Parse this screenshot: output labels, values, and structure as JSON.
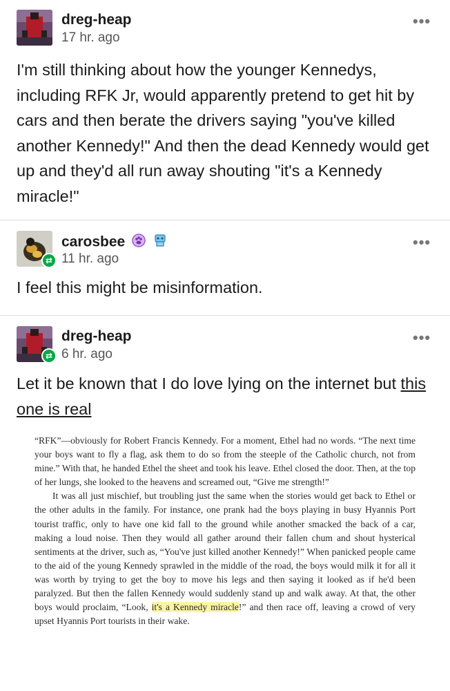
{
  "posts": [
    {
      "username": "dreg-heap",
      "time": "17 hr. ago",
      "body": "I'm still thinking about how the younger Kennedys, including RFK Jr, would apparently pretend to get hit by cars and then berate the drivers saying \"you've killed another Kennedy!\" And then the dead Kennedy would get up and they'd all run away shouting \"it's a Kennedy miracle!\""
    },
    {
      "username": "carosbee",
      "time": "11 hr. ago",
      "body": "I feel this might be misinformation."
    },
    {
      "username": "dreg-heap",
      "time": "6 hr. ago",
      "body_prefix": "Let it be known that I do love lying on the internet but ",
      "body_link": "this one is real"
    }
  ],
  "menu_glyph": "•••",
  "reblog_glyph": "⇄",
  "book_excerpt": {
    "para1": "“RFK”—obviously for Robert Francis Kennedy. For a moment, Ethel had no words. “The next time your boys want to fly a flag, ask them to do so from the steeple of the Catholic church, not from mine.” With that, he handed Ethel the sheet and took his leave. Ethel closed the door. Then, at the top of her lungs, she looked to the heavens and screamed out, “Give me strength!”",
    "para2_before": "It was all just mischief, but troubling just the same when the stories would get back to Ethel or the other adults in the family. For instance, one prank had the boys playing in busy Hyannis Port tourist traffic, only to have one kid fall to the ground while another smacked the back of a car, making a loud noise. Then they would all gather around their fallen chum and shout hysterical sentiments at the driver, such as, “You've just killed another Kennedy!” When panicked people came to the aid of the young Kennedy sprawled in the middle of the road, the boys would milk it for all it was worth by trying to get the boy to move his legs and then saying it looked as if he'd been paralyzed. But then the fallen Kennedy would suddenly stand up and walk away. At that, the other boys would proclaim, “Look, ",
    "para2_highlight": "it's a Kennedy miracle",
    "para2_after": "!” and then race off, leaving a crowd of very upset Hyannis Port tourists in their wake."
  },
  "colors": {
    "reblog_badge": "#00a846",
    "highlight": "#fbf4a6",
    "divider": "#dddddd"
  },
  "icons": [
    "user-avatar",
    "reblog-icon",
    "more-options-icon",
    "purple-badge-icon",
    "blue-badge-icon"
  ]
}
